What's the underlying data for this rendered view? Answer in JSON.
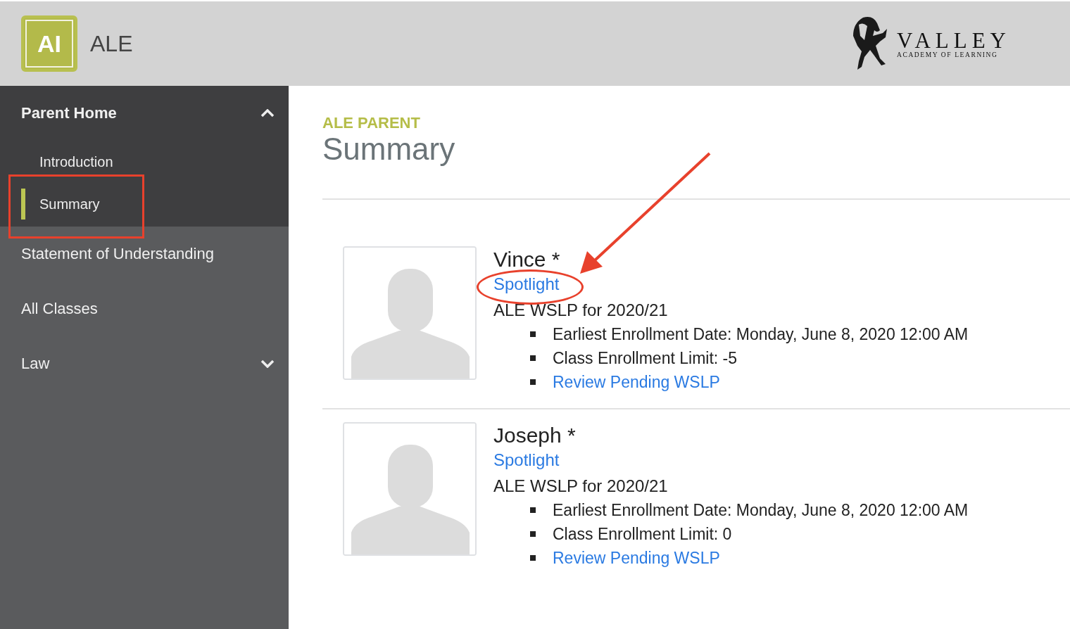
{
  "header": {
    "logo_text": "AI",
    "app_name": "ALE",
    "school_name": "VALLEY",
    "school_subtitle": "ACADEMY OF LEARNING"
  },
  "sidebar": {
    "items": [
      {
        "label": "Parent Home",
        "kind": "group",
        "expanded": true,
        "children": [
          {
            "label": "Introduction",
            "selected": false
          },
          {
            "label": "Summary",
            "selected": true
          }
        ]
      },
      {
        "label": "Statement of Understanding",
        "kind": "link",
        "selected": false
      },
      {
        "label": "All Classes",
        "kind": "link",
        "selected": false
      },
      {
        "label": "Law",
        "kind": "group",
        "expanded": false
      }
    ]
  },
  "page": {
    "eyebrow": "ALE PARENT",
    "title": "Summary"
  },
  "students": [
    {
      "name": "Vince *",
      "link": "Spotlight",
      "plan": "ALE WSLP for 2020/21",
      "details": [
        {
          "kind": "text",
          "text": "Earliest Enrollment Date: Monday, June 8, 2020 12:00 AM"
        },
        {
          "kind": "text",
          "text": "Class Enrollment Limit: -5"
        },
        {
          "kind": "link",
          "text": "Review Pending WSLP"
        }
      ]
    },
    {
      "name": "Joseph *",
      "link": "Spotlight",
      "plan": "ALE WSLP for 2020/21",
      "details": [
        {
          "kind": "text",
          "text": "Earliest Enrollment Date: Monday, June 8, 2020 12:00 AM"
        },
        {
          "kind": "text",
          "text": "Class Enrollment Limit: 0"
        },
        {
          "kind": "link",
          "text": "Review Pending WSLP"
        }
      ]
    }
  ],
  "annotations": [
    {
      "kind": "box"
    },
    {
      "kind": "arrow"
    },
    {
      "kind": "ellipse"
    }
  ]
}
